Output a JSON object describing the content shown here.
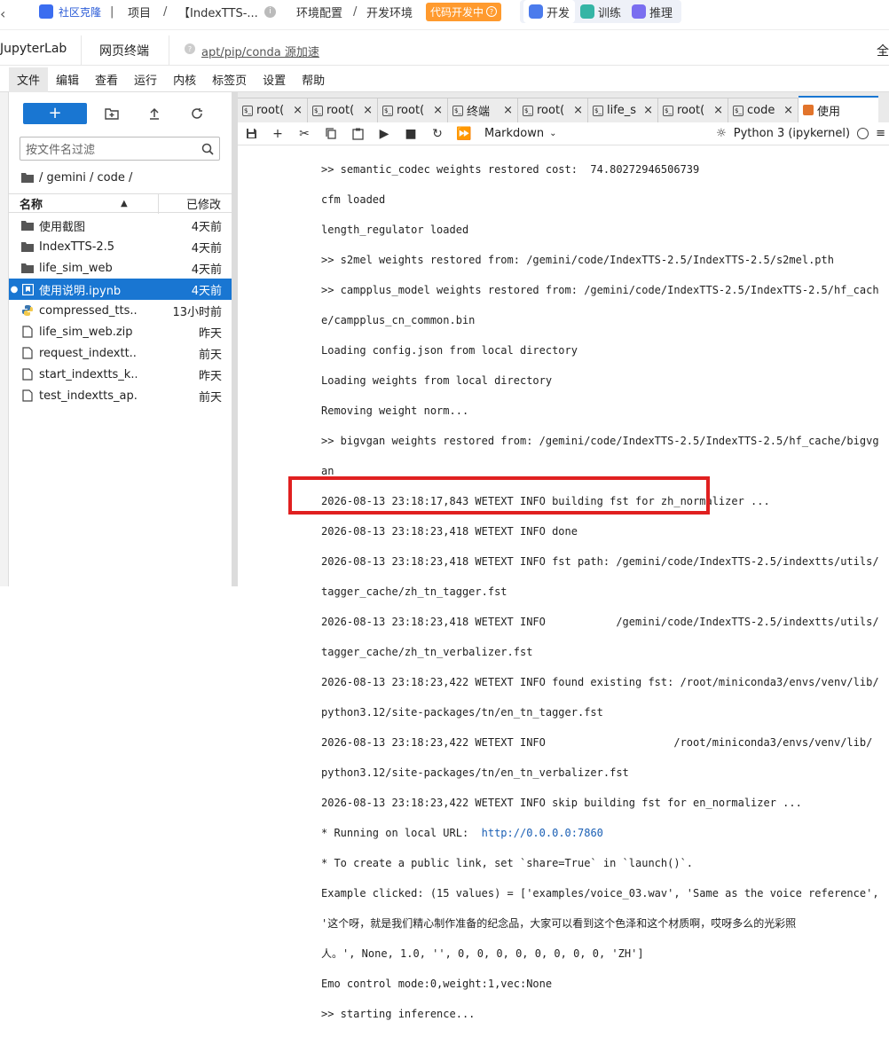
{
  "topbar": {
    "community": "社区克隆",
    "project": "项目",
    "instance": "【IndexTTS-...",
    "env": "环境配置",
    "devenv": "开发环境",
    "mode_badge": "代码开发中",
    "nav": [
      "开发",
      "训练",
      "推理"
    ]
  },
  "secondbar": {
    "jupyterlab": "JupyterLab",
    "terminal": "网页终端",
    "mirror": "apt/pip/conda 源加速",
    "full": "全"
  },
  "menu": [
    "文件",
    "编辑",
    "查看",
    "运行",
    "内核",
    "标签页",
    "设置",
    "帮助"
  ],
  "filebrowser": {
    "filter_placeholder": "按文件名过滤",
    "breadcrumb": "/ gemini / code /",
    "col_name": "名称",
    "col_modified": "已修改",
    "files": [
      {
        "name": "使用截图",
        "date": "4天前",
        "type": "folder"
      },
      {
        "name": "IndexTTS-2.5",
        "date": "4天前",
        "type": "folder"
      },
      {
        "name": "life_sim_web",
        "date": "4天前",
        "type": "folder"
      },
      {
        "name": "使用说明.ipynb",
        "date": "4天前",
        "type": "notebook",
        "selected": true
      },
      {
        "name": "compressed_tts...",
        "date": "13小时前",
        "type": "python"
      },
      {
        "name": "life_sim_web.zip",
        "date": "昨天",
        "type": "file"
      },
      {
        "name": "request_indextt...",
        "date": "前天",
        "type": "file"
      },
      {
        "name": "start_indextts_k...",
        "date": "昨天",
        "type": "file"
      },
      {
        "name": "test_indextts_ap...",
        "date": "前天",
        "type": "file"
      }
    ]
  },
  "tabs": [
    {
      "label": "root(",
      "close": "×",
      "icon": "terminal"
    },
    {
      "label": "root(",
      "close": "×",
      "icon": "terminal"
    },
    {
      "label": "root(",
      "close": "×",
      "icon": "terminal"
    },
    {
      "label": "终端",
      "close": "×",
      "icon": "terminal"
    },
    {
      "label": "root(",
      "close": "×",
      "icon": "terminal"
    },
    {
      "label": "life_s",
      "close": "×",
      "icon": "terminal"
    },
    {
      "label": "root(",
      "close": "×",
      "icon": "terminal"
    },
    {
      "label": "code",
      "close": "×",
      "icon": "terminal"
    },
    {
      "label": "使用",
      "close": "",
      "icon": "notebook",
      "active": true
    }
  ],
  "notebook_toolbar": {
    "cell_type": "Markdown",
    "kernel": "Python 3 (ipykernel)"
  },
  "output": {
    "lines": [
      ">> semantic_codec weights restored cost:  74.80272946506739",
      "cfm loaded",
      "length_regulator loaded",
      ">> s2mel weights restored from: /gemini/code/IndexTTS-2.5/IndexTTS-2.5/s2mel.pth",
      ">> campplus_model weights restored from: /gemini/code/IndexTTS-2.5/IndexTTS-2.5/hf_cach",
      "e/campplus_cn_common.bin",
      "Loading config.json from local directory",
      "Loading weights from local directory",
      "Removing weight norm...",
      ">> bigvgan weights restored from: /gemini/code/IndexTTS-2.5/IndexTTS-2.5/hf_cache/bigvg",
      "an",
      "2026-08-13 23:18:17,843 WETEXT INFO building fst for zh_normalizer ...",
      "2026-08-13 23:18:23,418 WETEXT INFO done",
      "2026-08-13 23:18:23,418 WETEXT INFO fst path: /gemini/code/IndexTTS-2.5/indextts/utils/",
      "tagger_cache/zh_tn_tagger.fst",
      "2026-08-13 23:18:23,418 WETEXT INFO           /gemini/code/IndexTTS-2.5/indextts/utils/",
      "tagger_cache/zh_tn_verbalizer.fst",
      "2026-08-13 23:18:23,422 WETEXT INFO found existing fst: /root/miniconda3/envs/venv/lib/",
      "python3.12/site-packages/tn/en_tn_tagger.fst",
      "2026-08-13 23:18:23,422 WETEXT INFO                    /root/miniconda3/envs/venv/lib/",
      "python3.12/site-packages/tn/en_tn_verbalizer.fst",
      "2026-08-13 23:18:23,422 WETEXT INFO skip building fst for en_normalizer ...",
      "* Running on local URL:  http://0.0.0.0:7860",
      "* To create a public link, set `share=True` in `launch()`.",
      "Example clicked: (15 values) = ['examples/voice_03.wav', 'Same as the voice reference',",
      "'这个呀，就是我们精心制作准备的纪念品，大家可以看到这个色泽和这个材质啊，哎呀多么的光彩照",
      "人。', None, 1.0, '', 0, 0, 0, 0, 0, 0, 0, 0, 'ZH']",
      "Emo control mode:0,weight:1,vec:None",
      ">> starting inference..."
    ]
  }
}
